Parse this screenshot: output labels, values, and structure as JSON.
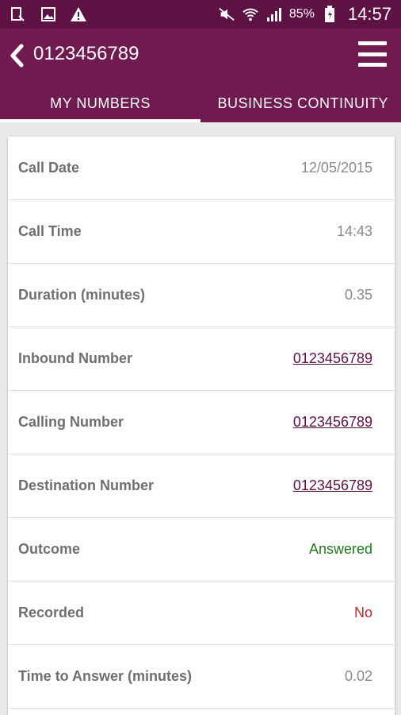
{
  "status_bar": {
    "battery": "85%",
    "time": "14:57",
    "icons": [
      "notification-icon",
      "image-icon",
      "warning-icon",
      "mute-icon",
      "wifi-icon",
      "signal-icon",
      "battery-icon"
    ]
  },
  "app_bar": {
    "title": "0123456789",
    "back_icon": "chevron-left-icon",
    "menu_icon": "hamburger-menu-icon"
  },
  "tabs": [
    {
      "label": "MY  NUMBERS",
      "active": true
    },
    {
      "label": "BUSINESS  CONTINUITY",
      "active": false
    }
  ],
  "details": [
    {
      "label": "Call Date",
      "value": "12/05/2015",
      "style": "plain"
    },
    {
      "label": "Call Time",
      "value": "14:43",
      "style": "plain"
    },
    {
      "label": "Duration (minutes)",
      "value": "0.35",
      "style": "plain"
    },
    {
      "label": "Inbound Number",
      "value": "0123456789",
      "style": "link"
    },
    {
      "label": "Calling Number",
      "value": "0123456789",
      "style": "link"
    },
    {
      "label": "Destination Number",
      "value": "0123456789",
      "style": "link"
    },
    {
      "label": "Outcome",
      "value": "Answered",
      "style": "green"
    },
    {
      "label": "Recorded",
      "value": "No",
      "style": "red"
    },
    {
      "label": "Time to Answer (minutes)",
      "value": "0.02",
      "style": "plain"
    }
  ],
  "colors": {
    "status_bar": "#5e1143",
    "app_bar": "#701a50",
    "link": "#5e1143",
    "answered": "#1d7a1d",
    "not_recorded": "#c62828"
  }
}
